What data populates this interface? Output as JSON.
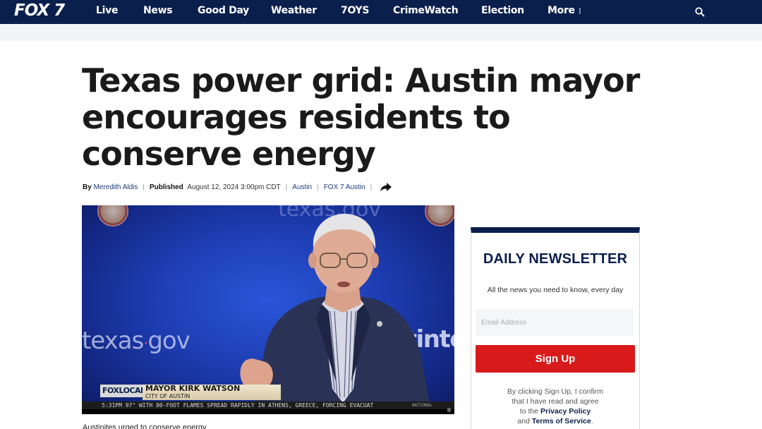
{
  "nav": {
    "logo": "FOX 7",
    "items": [
      "Live",
      "News",
      "Good Day",
      "Weather",
      "7OYS",
      "CrimeWatch",
      "Election",
      "More"
    ],
    "search_icon": "search-icon"
  },
  "article": {
    "headline": "Texas power grid: Austin mayor encourages residents to conserve energy",
    "byline": {
      "by_label": "By",
      "author": "Meredith Aldis",
      "published_label": "Published",
      "date": "August 12, 2024 3:00pm CDT",
      "tag1": "Austin",
      "tag2": "FOX 7 Austin",
      "share_icon": "share-icon"
    },
    "caption": "Austinites urged to conserve energy"
  },
  "video": {
    "bg_left": "texas",
    "bg_left_dot": "·",
    "bg_left_gov": "gov",
    "bg_right": "austintexa",
    "bg_top": "texas.gov",
    "lower_third_logo": "FOXLOCAL",
    "name": "MAYOR KIRK WATSON",
    "title": "CITY OF AUSTIN",
    "ticker": "5:31PM  97°  WITH 80-FOOT FLAMES SPREAD RAPIDLY IN ATHENS, GREECE, FORCING EVACUAT",
    "ticker_tag": "NATIONAL"
  },
  "newsletter": {
    "title": "DAILY NEWSLETTER",
    "subtitle": "All the news you need to know, every day",
    "email_placeholder": "Email Address",
    "button": "Sign Up",
    "legal_1": "By clicking Sign Up, I confirm",
    "legal_2": "that I have read and agree",
    "legal_3": "to the",
    "privacy": "Privacy Policy",
    "legal_4": "and",
    "terms": "Terms of Service",
    "legal_end": "."
  },
  "colors": {
    "nav_bg": "#0b1f4d",
    "accent_red": "#d91a1a",
    "link_blue": "#1f3a7a"
  }
}
